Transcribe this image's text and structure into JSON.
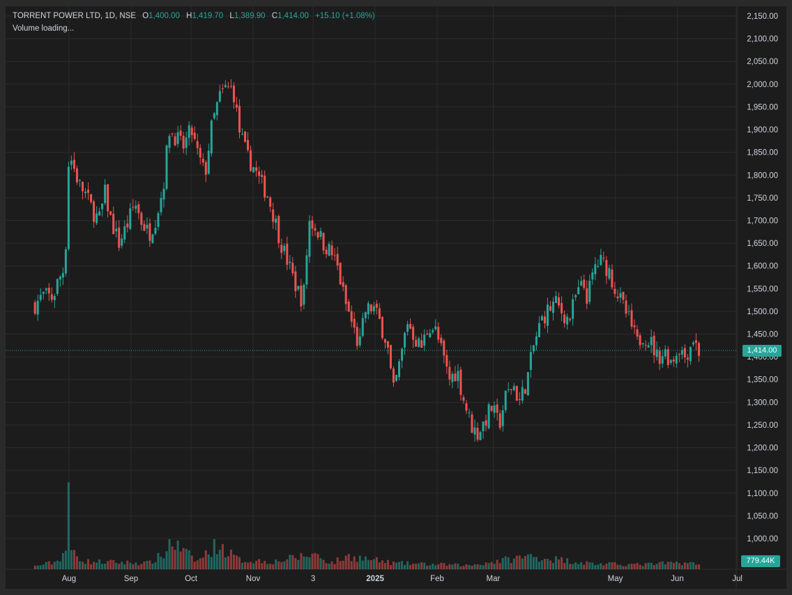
{
  "header": {
    "symbol": "TORRENT POWER LTD, 1D, NSE",
    "open_label": "O",
    "open": "1,400.00",
    "high_label": "H",
    "high": "1,419.70",
    "low_label": "L",
    "low": "1,389.90",
    "close_label": "C",
    "close": "1,414.00",
    "change": "+15.10 (+1.08%)",
    "volume_status": "Volume loading..."
  },
  "colors": {
    "up": "#26a69a",
    "down": "#ef5350",
    "background": "#1c1c1c",
    "grid": "#2b2b2b",
    "text": "#d1d4dc"
  },
  "chart_data": {
    "type": "candlestick",
    "title": "TORRENT POWER LTD, 1D, NSE",
    "x_ticks": [
      "Aug",
      "Sep",
      "Oct",
      "Nov",
      "3",
      "2025",
      "Feb",
      "Mar",
      "May",
      "Jun",
      "Jul"
    ],
    "y_ticks": [
      "2,150.00",
      "2,100.00",
      "2,050.00",
      "2,000.00",
      "1,950.00",
      "1,900.00",
      "1,850.00",
      "1,800.00",
      "1,750.00",
      "1,700.00",
      "1,650.00",
      "1,600.00",
      "1,550.00",
      "1,500.00",
      "1,450.00",
      "1,400.00",
      "1,350.00",
      "1,300.00",
      "1,250.00",
      "1,200.00",
      "1,150.00",
      "1,100.00",
      "1,050.00",
      "1,000.00"
    ],
    "ylim": [
      960,
      2165
    ],
    "last_price": 1414.0,
    "last_price_label": "1,414.00",
    "last_volume_label": "779.44K",
    "close_path": [
      [
        "2024-07-15",
        1515
      ],
      [
        "2024-07-19",
        1535
      ],
      [
        "2024-07-24",
        1530
      ],
      [
        "2024-07-26",
        1560
      ],
      [
        "2024-07-30",
        1600
      ],
      [
        "2024-08-01",
        1850
      ],
      [
        "2024-08-06",
        1780
      ],
      [
        "2024-08-09",
        1760
      ],
      [
        "2024-08-13",
        1720
      ],
      [
        "2024-08-16",
        1700
      ],
      [
        "2024-08-19",
        1760
      ],
      [
        "2024-08-22",
        1700
      ],
      [
        "2024-08-26",
        1650
      ],
      [
        "2024-08-30",
        1690
      ],
      [
        "2024-09-03",
        1740
      ],
      [
        "2024-09-06",
        1700
      ],
      [
        "2024-09-10",
        1670
      ],
      [
        "2024-09-13",
        1700
      ],
      [
        "2024-09-17",
        1770
      ],
      [
        "2024-09-20",
        1900
      ],
      [
        "2024-09-24",
        1880
      ],
      [
        "2024-09-27",
        1860
      ],
      [
        "2024-10-01",
        1900
      ],
      [
        "2024-10-04",
        1850
      ],
      [
        "2024-10-08",
        1800
      ],
      [
        "2024-10-11",
        1900
      ],
      [
        "2024-10-15",
        1970
      ],
      [
        "2024-10-18",
        1990
      ],
      [
        "2024-10-22",
        1990
      ],
      [
        "2024-10-25",
        1900
      ],
      [
        "2024-10-29",
        1840
      ],
      [
        "2024-11-01",
        1820
      ],
      [
        "2024-11-05",
        1780
      ],
      [
        "2024-11-08",
        1760
      ],
      [
        "2024-11-12",
        1700
      ],
      [
        "2024-11-15",
        1650
      ],
      [
        "2024-11-19",
        1600
      ],
      [
        "2024-11-22",
        1560
      ],
      [
        "2024-11-26",
        1520
      ],
      [
        "2024-11-29",
        1700
      ],
      [
        "2024-12-03",
        1680
      ],
      [
        "2024-12-06",
        1650
      ],
      [
        "2024-12-10",
        1630
      ],
      [
        "2024-12-13",
        1600
      ],
      [
        "2024-12-17",
        1520
      ],
      [
        "2024-12-20",
        1480
      ],
      [
        "2024-12-24",
        1420
      ],
      [
        "2024-12-27",
        1500
      ],
      [
        "2024-12-31",
        1510
      ],
      [
        "2025-01-03",
        1480
      ],
      [
        "2025-01-07",
        1430
      ],
      [
        "2025-01-10",
        1320
      ],
      [
        "2025-01-14",
        1400
      ],
      [
        "2025-01-17",
        1480
      ],
      [
        "2025-01-21",
        1440
      ],
      [
        "2025-01-24",
        1420
      ],
      [
        "2025-01-28",
        1470
      ],
      [
        "2025-01-31",
        1460
      ],
      [
        "2025-02-04",
        1400
      ],
      [
        "2025-02-07",
        1350
      ],
      [
        "2025-02-11",
        1370
      ],
      [
        "2025-02-14",
        1310
      ],
      [
        "2025-02-18",
        1250
      ],
      [
        "2025-02-21",
        1230
      ],
      [
        "2025-02-25",
        1260
      ],
      [
        "2025-02-28",
        1290
      ],
      [
        "2025-03-04",
        1250
      ],
      [
        "2025-03-07",
        1310
      ],
      [
        "2025-03-11",
        1340
      ],
      [
        "2025-03-14",
        1300
      ],
      [
        "2025-03-18",
        1350
      ],
      [
        "2025-03-21",
        1420
      ],
      [
        "2025-03-25",
        1480
      ],
      [
        "2025-03-28",
        1500
      ],
      [
        "2025-04-01",
        1520
      ],
      [
        "2025-04-04",
        1500
      ],
      [
        "2025-04-08",
        1480
      ],
      [
        "2025-04-11",
        1530
      ],
      [
        "2025-04-15",
        1560
      ],
      [
        "2025-04-17",
        1530
      ],
      [
        "2025-04-21",
        1600
      ],
      [
        "2025-04-24",
        1610
      ],
      [
        "2025-04-28",
        1590
      ],
      [
        "2025-04-30",
        1560
      ],
      [
        "2025-05-05",
        1510
      ],
      [
        "2025-05-08",
        1480
      ],
      [
        "2025-05-12",
        1430
      ],
      [
        "2025-05-15",
        1450
      ],
      [
        "2025-05-19",
        1430
      ],
      [
        "2025-05-22",
        1400
      ],
      [
        "2025-05-26",
        1410
      ],
      [
        "2025-05-29",
        1390
      ],
      [
        "2025-06-02",
        1420
      ],
      [
        "2025-06-05",
        1400
      ],
      [
        "2025-06-09",
        1440
      ],
      [
        "2025-06-12",
        1410
      ],
      [
        "2025-06-13",
        1414
      ]
    ],
    "volume_path": [
      [
        "2024-07-15",
        0.04
      ],
      [
        "2024-07-26",
        0.1
      ],
      [
        "2024-07-31",
        0.28
      ],
      [
        "2024-08-01",
        1.0
      ],
      [
        "2024-08-02",
        0.25
      ],
      [
        "2024-08-09",
        0.1
      ],
      [
        "2024-09-10",
        0.08
      ],
      [
        "2024-09-19",
        0.22
      ],
      [
        "2024-09-20",
        0.38
      ],
      [
        "2024-10-04",
        0.1
      ],
      [
        "2024-10-14",
        0.32
      ],
      [
        "2024-10-25",
        0.12
      ],
      [
        "2024-11-12",
        0.1
      ],
      [
        "2024-12-02",
        0.2
      ],
      [
        "2024-12-10",
        0.08
      ],
      [
        "2024-12-19",
        0.17
      ],
      [
        "2025-01-10",
        0.08
      ],
      [
        "2025-02-17",
        0.05
      ],
      [
        "2025-03-19",
        0.17
      ],
      [
        "2025-04-21",
        0.07
      ],
      [
        "2025-05-15",
        0.06
      ],
      [
        "2025-06-05",
        0.09
      ],
      [
        "2025-06-13",
        0.05
      ]
    ]
  }
}
